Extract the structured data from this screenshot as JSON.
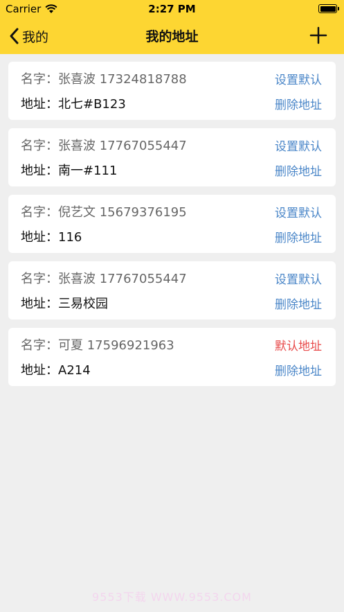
{
  "status": {
    "carrier": "Carrier",
    "time": "2:27 PM"
  },
  "nav": {
    "back_label": "我的",
    "title": "我的地址"
  },
  "addresses": [
    {
      "name_label": "名字：",
      "name": "张喜波",
      "phone": "17324818788",
      "addr_label": "地址：",
      "address": "北七#B123",
      "primary_action": "设置默认",
      "is_default": false,
      "delete_label": "删除地址"
    },
    {
      "name_label": "名字：",
      "name": "张喜波",
      "phone": "17767055447",
      "addr_label": "地址：",
      "address": "南一#111",
      "primary_action": "设置默认",
      "is_default": false,
      "delete_label": "删除地址"
    },
    {
      "name_label": "名字：",
      "name": "倪艺文",
      "phone": "15679376195",
      "addr_label": "地址：",
      "address": "116",
      "primary_action": "设置默认",
      "is_default": false,
      "delete_label": "删除地址"
    },
    {
      "name_label": "名字：",
      "name": "张喜波",
      "phone": "17767055447",
      "addr_label": "地址：",
      "address": "三易校园",
      "primary_action": "设置默认",
      "is_default": false,
      "delete_label": "删除地址"
    },
    {
      "name_label": "名字：",
      "name": "可夏",
      "phone": "17596921963",
      "addr_label": "地址：",
      "address": "A214",
      "primary_action": "默认地址",
      "is_default": true,
      "delete_label": "删除地址"
    }
  ],
  "watermark": "9553下载 WWW.9553.COM",
  "colors": {
    "header": "#fdd632",
    "link": "#4a86c8",
    "default": "#e84a4a",
    "background": "#efefef"
  }
}
